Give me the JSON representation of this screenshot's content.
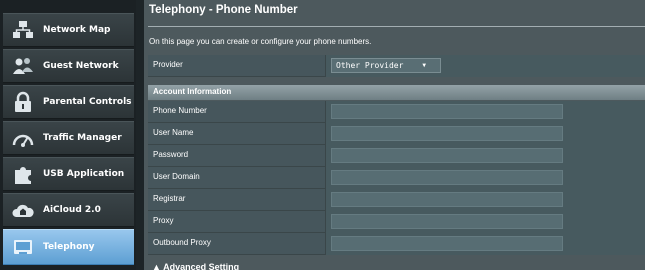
{
  "sidebar": {
    "items": [
      {
        "label": "Network Map",
        "icon": "network-map-icon",
        "active": false
      },
      {
        "label": "Guest Network",
        "icon": "guest-network-icon",
        "active": false
      },
      {
        "label": "Parental Controls",
        "icon": "lock-icon",
        "active": false
      },
      {
        "label": "Traffic Manager",
        "icon": "gauge-icon",
        "active": false
      },
      {
        "label": "USB Application",
        "icon": "puzzle-icon",
        "active": false
      },
      {
        "label": "AiCloud 2.0",
        "icon": "cloud-house-icon",
        "active": false
      },
      {
        "label": "Telephony",
        "icon": "telephony-icon",
        "active": true
      }
    ]
  },
  "main": {
    "title": "Telephony - Phone Number",
    "description": "On this page you can create or configure your phone numbers.",
    "provider": {
      "label": "Provider",
      "selected": "Other Provider"
    },
    "section": "Account Information",
    "fields": [
      {
        "label": "Phone Number",
        "value": ""
      },
      {
        "label": "User Name",
        "value": ""
      },
      {
        "label": "Password",
        "value": ""
      },
      {
        "label": "User Domain",
        "value": ""
      },
      {
        "label": "Registrar",
        "value": ""
      },
      {
        "label": "Proxy",
        "value": ""
      },
      {
        "label": "Outbound Proxy",
        "value": ""
      }
    ],
    "advanced": "▲ Advanced Setting"
  },
  "colors": {
    "active_nav": "#6aa8da",
    "panel": "#4d595d",
    "row": "#46565c",
    "section_header": "#85959a"
  }
}
